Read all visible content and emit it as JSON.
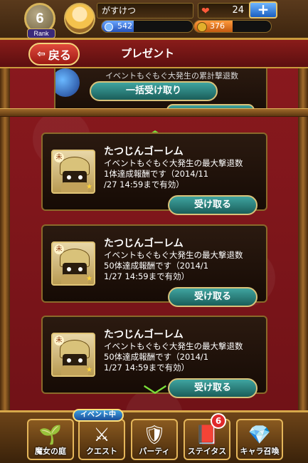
{
  "header": {
    "rank_value": "6",
    "rank_label": "Rank",
    "username": "がすけつ",
    "exp_value": "542",
    "exp_progress": 0.35,
    "stamina_value": "24",
    "gold_value": "376",
    "gold_progress": 0.5,
    "plus_label": "+"
  },
  "titlebar": {
    "back_label": "戻る",
    "title": "プレゼント"
  },
  "partial_item": {
    "text": "イベントもぐもぐ大発生の累計撃退数"
  },
  "bulk_button": "一括受け取り",
  "items": [
    {
      "name": "たつじんゴーレム",
      "description": "イベントもぐもぐ大発生の最大撃退数\n 1体達成報酬です（2014/11\n/27  14:59まで有効）",
      "button": "受け取る"
    },
    {
      "name": "たつじんゴーレム",
      "description": "イベントもぐもぐ大発生の最大撃退数\n 50体達成報酬です（2014/1\n1/27  14:59まで有効）",
      "button": "受け取る"
    },
    {
      "name": "たつじんゴーレム",
      "description": "イベントもぐもぐ大発生の最大撃退数\n 50体達成報酬です（2014/1\n1/27  14:59まで有効）",
      "button": "受け取る"
    }
  ],
  "icons": {
    "item_kanji": "未",
    "item_star": "★",
    "chevron_up": "︿",
    "chevron_down": "﹀",
    "back_arrow": "⇦"
  },
  "bottom_nav": {
    "event_badge": "イベント中",
    "status_badge_count": "6",
    "items": [
      {
        "label": "魔女の庭",
        "icon": "🌱"
      },
      {
        "label": "クエスト",
        "icon": "⚔"
      },
      {
        "label": "パーティ",
        "icon": "🛡"
      },
      {
        "label": "ステイタス",
        "icon": "📕"
      },
      {
        "label": "キャラ召喚",
        "icon": "💎"
      }
    ]
  },
  "colors": {
    "accent_gold": "#d7b45a",
    "button_teal": "#3fa4a0",
    "background_red": "#7a1418",
    "chevron_green": "#7be03a"
  }
}
